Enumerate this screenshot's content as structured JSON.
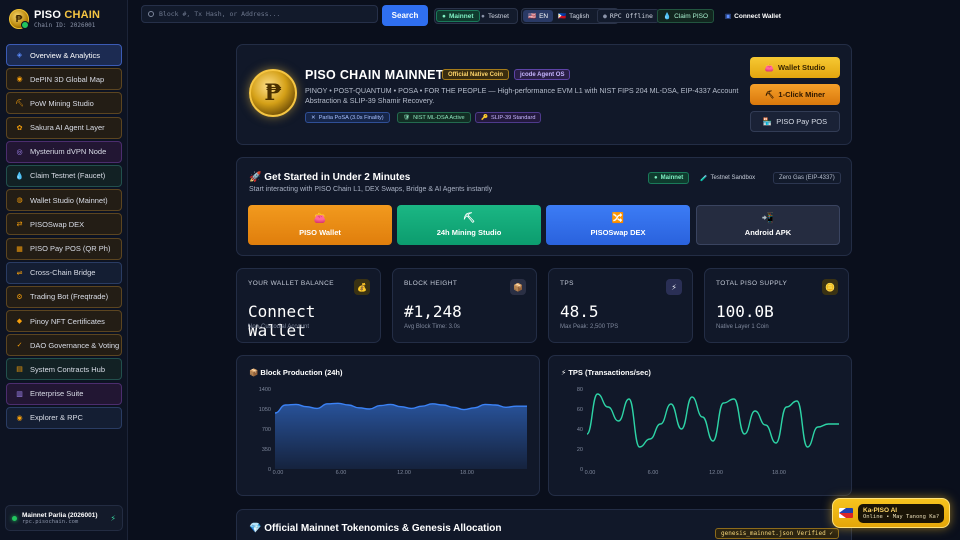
{
  "brand": {
    "name_a": "PISO",
    "name_b": "CHAIN",
    "chain_id": "Chain ID: 2026001",
    "logo_glyph": "₱"
  },
  "sidebar": {
    "items": [
      {
        "label": "Overview & Analytics",
        "icon": "chart-icon",
        "glyph": "◈",
        "color": "#5b8cff"
      },
      {
        "label": "DePIN 3D Global Map",
        "icon": "globe-icon",
        "glyph": "◉",
        "color": "#f59e0b"
      },
      {
        "label": "PoW Mining Studio",
        "icon": "pickaxe-icon",
        "glyph": "⛏",
        "color": "#f59e0b"
      },
      {
        "label": "Sakura AI Agent Layer",
        "icon": "robot-icon",
        "glyph": "✿",
        "color": "#f59e0b"
      },
      {
        "label": "Mysterium dVPN Node",
        "icon": "node-icon",
        "glyph": "◎",
        "color": "#a78bfa"
      },
      {
        "label": "Claim Testnet (Faucet)",
        "icon": "droplet-icon",
        "glyph": "💧",
        "color": "#38bdf8"
      },
      {
        "label": "Wallet Studio (Mainnet)",
        "icon": "wallet-icon",
        "glyph": "◍",
        "color": "#f59e0b"
      },
      {
        "label": "PISOSwap DEX",
        "icon": "swap-icon",
        "glyph": "⇄",
        "color": "#f59e0b"
      },
      {
        "label": "PISO Pay POS (QR Ph)",
        "icon": "qr-icon",
        "glyph": "▦",
        "color": "#f59e0b"
      },
      {
        "label": "Cross-Chain Bridge",
        "icon": "bridge-icon",
        "glyph": "⇌",
        "color": "#f59e0b"
      },
      {
        "label": "Trading Bot (Freqtrade)",
        "icon": "bot-icon",
        "glyph": "⚙",
        "color": "#f59e0b"
      },
      {
        "label": "Pinoy NFT Certificates",
        "icon": "certificate-icon",
        "glyph": "◆",
        "color": "#f59e0b"
      },
      {
        "label": "DAO Governance & Voting",
        "icon": "vote-icon",
        "glyph": "✓",
        "color": "#f59e0b"
      },
      {
        "label": "System Contracts Hub",
        "icon": "contract-icon",
        "glyph": "▤",
        "color": "#f59e0b"
      },
      {
        "label": "Enterprise Suite",
        "icon": "building-icon",
        "glyph": "▥",
        "color": "#a78bfa"
      },
      {
        "label": "Explorer & RPC",
        "icon": "explorer-icon",
        "glyph": "◉",
        "color": "#f59e0b"
      }
    ],
    "footer": {
      "title": "Mainnet Parlia (2026001)",
      "url": "rpc.pisochain.com"
    }
  },
  "topbar": {
    "search_placeholder": "Block #, Tx Hash, or Address...",
    "search_button": "Search",
    "network_mainnet": "Mainnet",
    "network_testnet": "Testnet",
    "lang_en": "EN",
    "lang_taglish": "Taglish",
    "rpc_status": "RPC Offline",
    "claim": "Claim PISO",
    "connect": "Connect Wallet"
  },
  "hero": {
    "title": "PISO CHAIN MAINNET",
    "badge_native": "Official Native Coin",
    "badge_os": "jcode Agent OS",
    "desc": "PINOY • POST-QUANTUM • POSA • FOR THE PEOPLE — High-performance EVM L1 with NIST FIPS 204 ML-DSA, EIP-4337 Account Abstraction & SLIP-39 Shamir Recovery.",
    "tags": [
      "Parlia PoSA (3.0s Finality)",
      "NIST ML-DSA Active",
      "SLIP-39 Standard"
    ],
    "btn_wallet": "Wallet Studio",
    "btn_miner": "1-Click Miner",
    "btn_pos": "PISO Pay POS"
  },
  "start": {
    "title": "🚀 Get Started in Under 2 Minutes",
    "sub": "Start interacting with PISO Chain L1, DEX Swaps, Bridge & AI Agents instantly",
    "mainnet": "Mainnet",
    "testnet": "Testnet Sandbox",
    "gas": "Zero Gas (EIP-4337)",
    "tiles": [
      "PISO Wallet",
      "24h Mining Studio",
      "PISOSwap DEX",
      "Android APK"
    ]
  },
  "stats": [
    {
      "label": "YOUR WALLET BALANCE",
      "value": "Connect Wallet",
      "sub": "Non-Custodial Account",
      "icon": "money-bag-icon",
      "glyph": "💰",
      "bg": "#3a3213"
    },
    {
      "label": "BLOCK HEIGHT",
      "value": "#1,248",
      "sub": "Avg Block Time: 3.0s",
      "icon": "package-icon",
      "glyph": "📦",
      "bg": "#2a2f44"
    },
    {
      "label": "TPS",
      "value": "48.5",
      "sub": "Max Peak: 2,500 TPS",
      "icon": "bolt-icon",
      "glyph": "⚡",
      "bg": "#2a2f55"
    },
    {
      "label": "TOTAL PISO SUPPLY",
      "value": "100.0B",
      "sub": "Native Layer 1 Coin",
      "icon": "coin-icon",
      "glyph": "🪙",
      "bg": "#3a3213"
    }
  ],
  "tokenomics": {
    "title": "💎 Official Mainnet Tokenomics & Genesis Allocation",
    "badge": "genesis_mainnet.json Verified ✓"
  },
  "assistant": {
    "title": "Ka-PISO AI",
    "sub": "Online • May Tanong Ka?"
  },
  "chart_data": [
    {
      "type": "area",
      "title": "📦 Block Production (24h)",
      "xlabel": "",
      "ylabel": "",
      "x_ticks": [
        "0.00",
        "6.00",
        "12.00",
        "18.00"
      ],
      "y_ticks": [
        0,
        350,
        700,
        1050,
        1400
      ],
      "ylim": [
        0,
        1400
      ],
      "x": [
        0,
        1,
        2,
        3,
        4,
        5,
        6,
        7,
        8,
        9,
        10,
        11,
        12,
        13,
        14,
        15,
        16,
        17,
        18,
        19,
        20,
        21,
        22,
        23
      ],
      "values": [
        980,
        1120,
        1130,
        1090,
        1060,
        1140,
        1150,
        1120,
        1070,
        1050,
        1110,
        1130,
        1090,
        1060,
        1100,
        1140,
        1120,
        1080,
        1040,
        1070,
        1130,
        1120,
        1080,
        1100
      ],
      "color": "#3b82f6"
    },
    {
      "type": "line",
      "title": "⚡ TPS (Transactions/sec)",
      "xlabel": "",
      "ylabel": "",
      "x_ticks": [
        "0.00",
        "6.00",
        "12.00",
        "18.00"
      ],
      "y_ticks": [
        0,
        20,
        40,
        60,
        80
      ],
      "ylim": [
        0,
        80
      ],
      "x": [
        0,
        1,
        2,
        3,
        4,
        5,
        6,
        7,
        8,
        9,
        10,
        11,
        12,
        13,
        14,
        15,
        16,
        17,
        18,
        19,
        20,
        21,
        22,
        23
      ],
      "values": [
        35,
        75,
        62,
        48,
        70,
        22,
        30,
        45,
        65,
        40,
        72,
        52,
        28,
        66,
        70,
        35,
        58,
        44,
        26,
        62,
        68,
        22,
        42,
        45
      ],
      "color": "#2dd4a6"
    }
  ]
}
